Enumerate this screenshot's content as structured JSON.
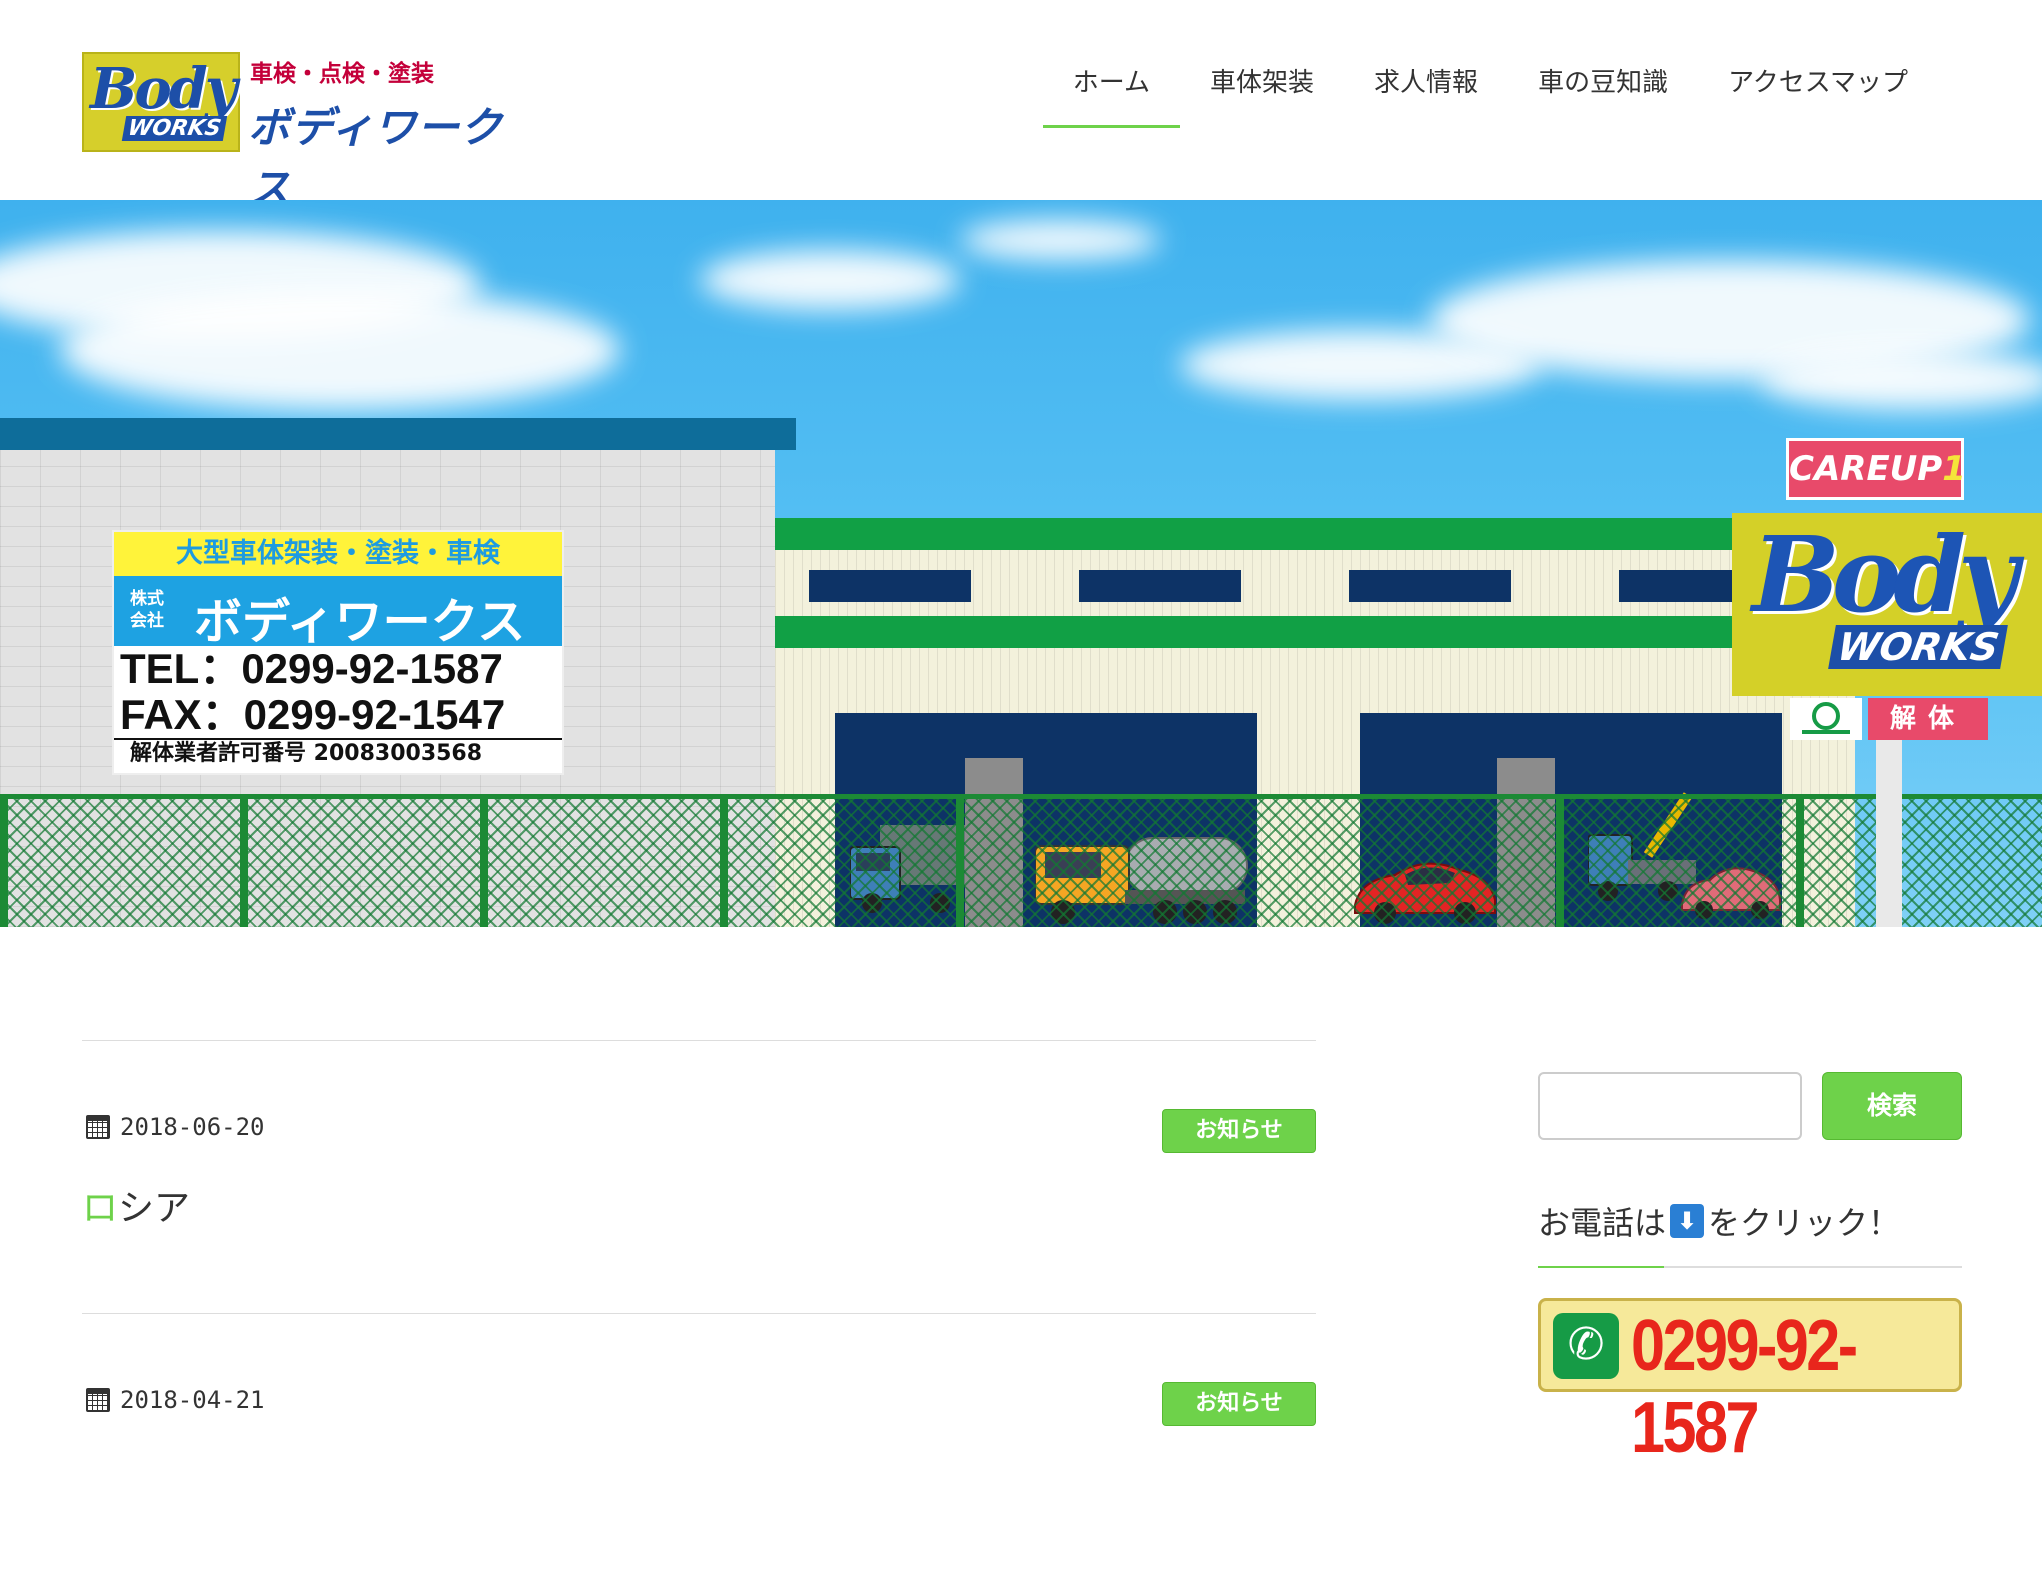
{
  "header": {
    "logo_badge_top": "Body",
    "logo_badge_bottom": "WORKS",
    "logo_tagline": "車検・点検・塗装",
    "logo_name": "ボディワークス"
  },
  "nav": {
    "items": [
      {
        "label": "ホーム",
        "active": true
      },
      {
        "label": "車体架装",
        "active": false
      },
      {
        "label": "求人情報",
        "active": false
      },
      {
        "label": "車の豆知識",
        "active": false
      },
      {
        "label": "アクセスマップ",
        "active": false
      }
    ]
  },
  "hero": {
    "sign_line1": "大型車体架装・塗装・車検",
    "sign_company_type_1": "株式",
    "sign_company_type_2": "会社",
    "sign_company_name": "ボディワークス",
    "sign_tel": "TEL：0299-92-1587",
    "sign_fax": "FAX：0299-92-1547",
    "sign_license": "解体業者許可番号 20083003568",
    "careup_text": "CAREUP",
    "careup_num": "1",
    "pole_sign_top": "Body",
    "pole_sign_bottom": "WORKS",
    "kaitai": "解体"
  },
  "posts": [
    {
      "date": "2018-06-20",
      "category": "お知らせ",
      "title_first": "ロ",
      "title_rest": "シア"
    },
    {
      "date": "2018-04-21",
      "category": "お知らせ",
      "title_first": "",
      "title_rest": ""
    }
  ],
  "sidebar": {
    "search_placeholder": "",
    "search_button": "検索",
    "phone_heading_before": "お電話は",
    "phone_heading_icon": "⬇",
    "phone_heading_after": "をクリック！",
    "phone_number": "0299-92-1587",
    "phone_icon_glyph": "✆"
  },
  "colors": {
    "accent": "#6ed24a",
    "brand_blue": "#1d4fa8",
    "brand_yellow": "#d6cf2b",
    "phone_red": "#e8261c"
  }
}
